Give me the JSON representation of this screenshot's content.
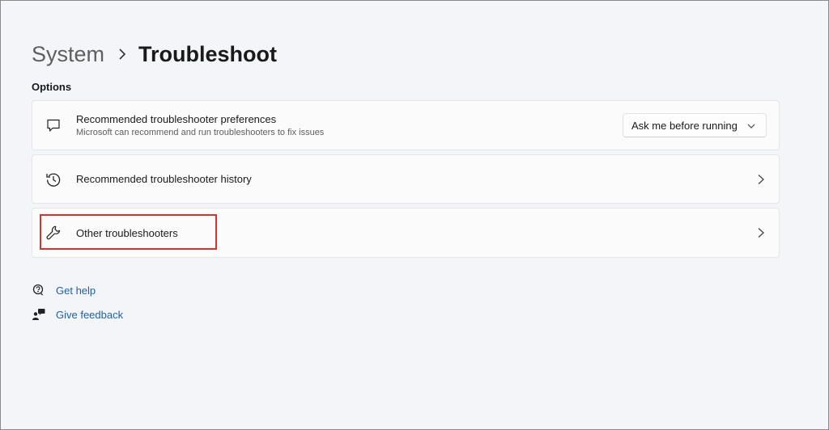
{
  "breadcrumb": {
    "parent": "System",
    "separator_icon": "chevron-right-icon",
    "current": "Troubleshoot"
  },
  "options": {
    "label": "Options",
    "items": [
      {
        "icon": "chat-bubble-icon",
        "title": "Recommended troubleshooter preferences",
        "subtitle": "Microsoft can recommend and run troubleshooters to fix issues",
        "dropdown_value": "Ask me before running"
      },
      {
        "icon": "history-icon",
        "title": "Recommended troubleshooter history"
      },
      {
        "icon": "wrench-icon",
        "title": "Other troubleshooters",
        "highlighted": true
      }
    ]
  },
  "links": {
    "help": "Get help",
    "feedback": "Give feedback"
  },
  "colors": {
    "background": "#f3f5f9",
    "card": "#fbfbfb",
    "link": "#1f5fa8",
    "highlight": "#d6332e"
  }
}
